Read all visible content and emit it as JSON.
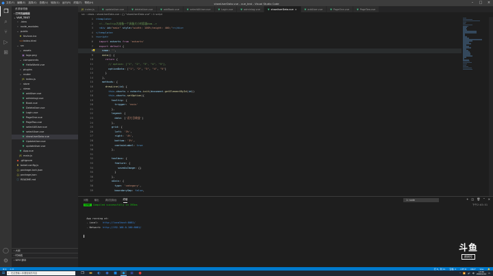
{
  "window": {
    "title": "showUserData.vue - vue_test - Visual Studio Code",
    "menu": [
      "文件(F)",
      "编辑(E)",
      "选择(S)",
      "查看(V)",
      "转到(G)",
      "运行(R)",
      "终端(T)",
      "帮助(H)"
    ]
  },
  "sidebar": {
    "header": "资源管理器",
    "open_editors": "打开的编辑器",
    "project": "VUE_TEST",
    "items": [
      {
        "label": ".idea",
        "icon": "chevron-right",
        "depth": 1
      },
      {
        "label": "node_modules",
        "icon": "chevron-right",
        "depth": 1
      },
      {
        "label": "public",
        "icon": "chevron-down",
        "depth": 1
      },
      {
        "label": "favicon.ico",
        "icon": "star",
        "depth": 2
      },
      {
        "label": "index.html",
        "icon": "html",
        "depth": 2
      },
      {
        "label": "src",
        "icon": "chevron-down",
        "depth": 1
      },
      {
        "label": "assets",
        "icon": "chevron-down",
        "depth": 2
      },
      {
        "label": "logo.png",
        "icon": "image",
        "depth": 3
      },
      {
        "label": "components",
        "icon": "chevron-down",
        "depth": 2
      },
      {
        "label": "HelloWorld.vue",
        "icon": "vue",
        "depth": 3
      },
      {
        "label": "plugins",
        "icon": "chevron-right",
        "depth": 2
      },
      {
        "label": "router",
        "icon": "chevron-down",
        "depth": 2
      },
      {
        "label": "index.js",
        "icon": "js",
        "depth": 3
      },
      {
        "label": "store",
        "icon": "chevron-right",
        "depth": 2
      },
      {
        "label": "views",
        "icon": "chevron-down",
        "depth": 2
      },
      {
        "label": "addUser.vue",
        "icon": "vue",
        "depth": 3
      },
      {
        "label": "adminlogi.vue",
        "icon": "vue",
        "depth": 3
      },
      {
        "label": "Book.vue",
        "icon": "vue",
        "depth": 3
      },
      {
        "label": "DeleteUser.vue",
        "icon": "vue",
        "depth": 3
      },
      {
        "label": "Login.vue",
        "icon": "vue",
        "depth": 3
      },
      {
        "label": "PageOne.vue",
        "icon": "vue",
        "depth": 3
      },
      {
        "label": "PageTwo.vue",
        "icon": "vue",
        "depth": 3
      },
      {
        "label": "selectAllUser.vue",
        "icon": "vue",
        "depth": 3
      },
      {
        "label": "selectUser.vue",
        "icon": "vue",
        "depth": 3
      },
      {
        "label": "showUserData.vue",
        "icon": "vue",
        "depth": 3,
        "selected": true
      },
      {
        "label": "UpdateUser.vue",
        "icon": "vue",
        "depth": 3
      },
      {
        "label": "updateUser.vue",
        "icon": "vue",
        "depth": 3
      },
      {
        "label": "App.vue",
        "icon": "vue",
        "depth": 2
      },
      {
        "label": "main.js",
        "icon": "js",
        "depth": 2
      },
      {
        "label": ".gitignore",
        "icon": "git",
        "depth": 1
      },
      {
        "label": "babel.config.js",
        "icon": "babel",
        "depth": 1
      },
      {
        "label": "package-lock.json",
        "icon": "json",
        "depth": 1
      },
      {
        "label": "package.json",
        "icon": "json",
        "depth": 1
      },
      {
        "label": "README.md",
        "icon": "info",
        "depth": 1
      }
    ],
    "footer": [
      "大纲",
      "时间线",
      "NPM 脚本"
    ]
  },
  "tabs": [
    {
      "label": "index.js",
      "type": "js"
    },
    {
      "label": "updateUser.vue",
      "type": "vue"
    },
    {
      "label": "deleteUser.vue",
      "type": "vue"
    },
    {
      "label": "addBook.vue",
      "type": "vue"
    },
    {
      "label": "selectAllUser.vue",
      "type": "vue"
    },
    {
      "label": "Login.vue",
      "type": "vue"
    },
    {
      "label": "adminlog.vue",
      "type": "vue"
    },
    {
      "label": "showUserData.vue",
      "type": "vue",
      "active": true
    },
    {
      "label": "addUser.vue",
      "type": "vue"
    },
    {
      "label": "PageOne.vue",
      "type": "vue"
    },
    {
      "label": "PageTwo.vue",
      "type": "vue"
    }
  ],
  "breadcrumb": "src › views › showUserData.vue › {} \"showUserData.vue\" › ⊙ script",
  "editor": {
    "current_line": 8,
    "lines": [
      [
        1,
        [
          [
            "tag",
            "<template>"
          ]
        ]
      ],
      [
        2,
        [
          [
            "cm",
            "  <!--Tooltip为准备一个具备大小的容器dom-->"
          ]
        ]
      ],
      [
        3,
        [
          [
            "tag",
            "  <div "
          ],
          [
            "v",
            "id"
          ],
          [
            "",
            "="
          ],
          [
            "s",
            "\"main\""
          ],
          [
            "v",
            " style"
          ],
          [
            "",
            "="
          ],
          [
            "s",
            "\"width: 100%;height: 400;\""
          ],
          [
            "tag",
            "></div>"
          ]
        ]
      ],
      [
        4,
        [
          [
            "tag",
            "</template>"
          ]
        ]
      ],
      [
        5,
        [
          [
            "tag",
            "<script>"
          ]
        ]
      ],
      [
        6,
        [
          [
            "c",
            "  import "
          ],
          [
            "v",
            "echarts"
          ],
          [
            "c",
            " from "
          ],
          [
            "s",
            "'echarts'"
          ]
        ]
      ],
      [
        7,
        [
          [
            "c",
            "  export default "
          ],
          [
            "",
            "{"
          ]
        ]
      ],
      [
        8,
        [
          [
            "v",
            "    name"
          ],
          [
            "",
            ": "
          ],
          [
            "s",
            "''"
          ],
          [
            "",
            ","
          ]
        ]
      ],
      [
        9,
        [
          [
            "f",
            "    data"
          ],
          [
            "",
            "() {"
          ]
        ]
      ],
      [
        10,
        [
          [
            "c",
            "      return "
          ],
          [
            "",
            "{"
          ]
        ]
      ],
      [
        11,
        [
          [
            "cm",
            "        // option: [\"1\", \"2\", \"3\", \"4\", \"5\"],"
          ]
        ]
      ],
      [
        12,
        [
          [
            "v",
            "        optionData"
          ],
          [
            "",
            ": ["
          ],
          [
            "s",
            "\"1\""
          ],
          [
            "",
            ", "
          ],
          [
            "s",
            "\"2\""
          ],
          [
            "",
            ", "
          ],
          [
            "s",
            "\"3\""
          ],
          [
            "",
            ", "
          ],
          [
            "s",
            "\"4\""
          ],
          [
            "",
            ", "
          ],
          [
            "s",
            "\"5\""
          ],
          [
            "",
            "]"
          ]
        ]
      ],
      [
        13,
        [
          [
            "",
            "      }"
          ]
        ]
      ],
      [
        14,
        [
          [
            "",
            "    },"
          ]
        ]
      ],
      [
        15,
        [
          [
            "v",
            "    methods"
          ],
          [
            "",
            ": {"
          ]
        ]
      ],
      [
        16,
        [
          [
            "f",
            "      drawLine"
          ],
          [
            "",
            "("
          ],
          [
            "v",
            "id"
          ],
          [
            "",
            ") {"
          ]
        ]
      ],
      [
        17,
        [
          [
            "k",
            "        this"
          ],
          [
            "",
            "."
          ],
          [
            "v",
            "charts"
          ],
          [
            "",
            " = "
          ],
          [
            "v",
            "echarts"
          ],
          [
            "",
            "."
          ],
          [
            "f",
            "init"
          ],
          [
            "",
            "("
          ],
          [
            "v",
            "document"
          ],
          [
            "",
            "."
          ],
          [
            "f",
            "getElementById"
          ],
          [
            "",
            "("
          ],
          [
            "v",
            "id"
          ],
          [
            "",
            "))"
          ]
        ]
      ],
      [
        18,
        [
          [
            "k",
            "        this"
          ],
          [
            "",
            "."
          ],
          [
            "v",
            "charts"
          ],
          [
            "",
            "."
          ],
          [
            "f",
            "setOption"
          ],
          [
            "",
            "({"
          ]
        ]
      ],
      [
        19,
        [
          [
            "v",
            "          tooltip"
          ],
          [
            "",
            ": {"
          ]
        ]
      ],
      [
        20,
        [
          [
            "v",
            "            trigger"
          ],
          [
            "",
            ": "
          ],
          [
            "s",
            "'axis'"
          ]
        ]
      ],
      [
        21,
        [
          [
            "",
            "          },"
          ]
        ]
      ],
      [
        22,
        [
          [
            "v",
            "          legend"
          ],
          [
            "",
            ": {"
          ]
        ]
      ],
      [
        23,
        [
          [
            "v",
            "            data"
          ],
          [
            "",
            ": ["
          ],
          [
            "s",
            "'近七日收益'"
          ],
          [
            "",
            "]"
          ]
        ]
      ],
      [
        24,
        [
          [
            "",
            "          },"
          ]
        ]
      ],
      [
        25,
        [
          [
            "v",
            "          grid"
          ],
          [
            "",
            ": {"
          ]
        ]
      ],
      [
        26,
        [
          [
            "v",
            "            left"
          ],
          [
            "",
            ": "
          ],
          [
            "s",
            "'3%'"
          ],
          [
            "",
            ","
          ]
        ]
      ],
      [
        27,
        [
          [
            "v",
            "            right"
          ],
          [
            "",
            ": "
          ],
          [
            "s",
            "'4%'"
          ],
          [
            "",
            ","
          ]
        ]
      ],
      [
        28,
        [
          [
            "v",
            "            bottom"
          ],
          [
            "",
            ": "
          ],
          [
            "s",
            "'3%'"
          ],
          [
            "",
            ","
          ]
        ]
      ],
      [
        29,
        [
          [
            "v",
            "            containLabel"
          ],
          [
            "",
            ": "
          ],
          [
            "k",
            "true"
          ]
        ]
      ],
      [
        30,
        [
          [
            "",
            "          },"
          ]
        ]
      ],
      [
        31,
        [
          [
            "",
            ""
          ]
        ]
      ],
      [
        32,
        [
          [
            "v",
            "          toolbox"
          ],
          [
            "",
            ": {"
          ]
        ]
      ],
      [
        33,
        [
          [
            "v",
            "            feature"
          ],
          [
            "",
            ": {"
          ]
        ]
      ],
      [
        34,
        [
          [
            "v",
            "              saveAsImage"
          ],
          [
            "",
            ": {}"
          ]
        ]
      ],
      [
        35,
        [
          [
            "",
            "            }"
          ]
        ]
      ],
      [
        36,
        [
          [
            "",
            "          },"
          ]
        ]
      ],
      [
        37,
        [
          [
            "v",
            "          xAxis"
          ],
          [
            "",
            ": {"
          ]
        ]
      ],
      [
        38,
        [
          [
            "v",
            "            type"
          ],
          [
            "",
            ": "
          ],
          [
            "s",
            "'category'"
          ],
          [
            "",
            ","
          ]
        ]
      ],
      [
        39,
        [
          [
            "v",
            "            boundaryGap"
          ],
          [
            "",
            ": "
          ],
          [
            "k",
            "false"
          ],
          [
            "",
            ","
          ]
        ]
      ]
    ]
  },
  "panel": {
    "tabs": [
      "问题",
      "输出",
      "调试控制台",
      "终端"
    ],
    "active_tab": "终端",
    "terminal_select": "1: node",
    "lines": [
      {
        "parts": [
          [
            "badge",
            "DONE"
          ],
          [
            "ok",
            " Compiled successfully in 393ms"
          ]
        ],
        "right": "下午2:03:51"
      },
      {
        "parts": [
          [
            "",
            ""
          ]
        ]
      },
      {
        "parts": [
          [
            "",
            ""
          ]
        ]
      },
      {
        "parts": [
          [
            "",
            "  App running at:"
          ]
        ]
      },
      {
        "parts": [
          [
            "",
            "  - Local:   "
          ],
          [
            "url",
            "http://localhost:8081/"
          ]
        ]
      },
      {
        "parts": [
          [
            "",
            "  - Network: "
          ],
          [
            "url",
            "http://192.168.0.100:8081/"
          ]
        ]
      },
      {
        "parts": [
          [
            "",
            ""
          ]
        ]
      },
      {
        "parts": [
          [
            "",
            "▌"
          ]
        ]
      }
    ]
  },
  "statusbar": {
    "left": [
      "⊗ 0",
      "⚠ 0"
    ],
    "right": [
      "行 8，列 11",
      "空格: 2",
      "UTF-8",
      "CRLF",
      "Vue"
    ]
  },
  "taskbar": {
    "search_placeholder": "在这里输入你要搜索的内容",
    "time": "13:50",
    "date": "2020/4/14",
    "lang": "中"
  },
  "watermark": {
    "big": "斗鱼",
    "small": "房间号"
  },
  "colors": {
    "accent": "#007acc",
    "tab_active": "#1e1e1e",
    "sidebar": "#252526",
    "activity": "#333333"
  }
}
